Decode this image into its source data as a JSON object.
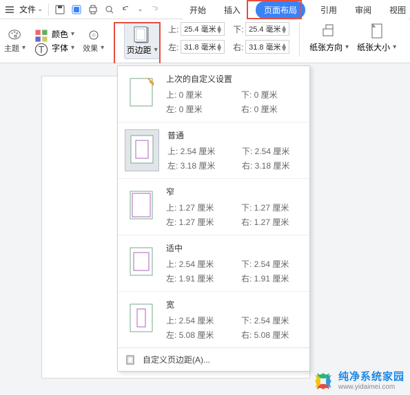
{
  "titlebar": {
    "file_menu": "文件"
  },
  "tabs": {
    "start": "开始",
    "insert": "插入",
    "page_layout": "页面布局",
    "reference": "引用",
    "review": "审阅",
    "view": "视图"
  },
  "ribbon": {
    "theme": "主题",
    "color": "颜色",
    "font": "字体",
    "effect": "效果",
    "margins": "页边距",
    "margin_values": {
      "top": {
        "label": "上:",
        "value": "25.4 毫米"
      },
      "bottom": {
        "label": "下:",
        "value": "25.4 毫米"
      },
      "left": {
        "label": "左:",
        "value": "31.8 毫米"
      },
      "right": {
        "label": "右:",
        "value": "31.8 毫米"
      }
    },
    "orientation": "纸张方向",
    "size": "纸张大小"
  },
  "dropdown": {
    "options": [
      {
        "title": "上次的自定义设置",
        "top": "上: 0 厘米",
        "bottom": "下: 0 厘米",
        "left": "左: 0 厘米",
        "right": "右: 0 厘米"
      },
      {
        "title": "普通",
        "top": "上: 2.54 厘米",
        "bottom": "下: 2.54 厘米",
        "left": "左: 3.18 厘米",
        "right": "右: 3.18 厘米"
      },
      {
        "title": "窄",
        "top": "上: 1.27 厘米",
        "bottom": "下: 1.27 厘米",
        "left": "左: 1.27 厘米",
        "right": "右: 1.27 厘米"
      },
      {
        "title": "适中",
        "top": "上: 2.54 厘米",
        "bottom": "下: 2.54 厘米",
        "left": "左: 1.91 厘米",
        "right": "右: 1.91 厘米"
      },
      {
        "title": "宽",
        "top": "上: 2.54 厘米",
        "bottom": "下: 2.54 厘米",
        "left": "左: 5.08 厘米",
        "right": "右: 5.08 厘米"
      }
    ],
    "custom": "自定义页边距(A)..."
  },
  "watermark": {
    "cn": "纯净系统家园",
    "url": "www.yidaimei.com"
  }
}
